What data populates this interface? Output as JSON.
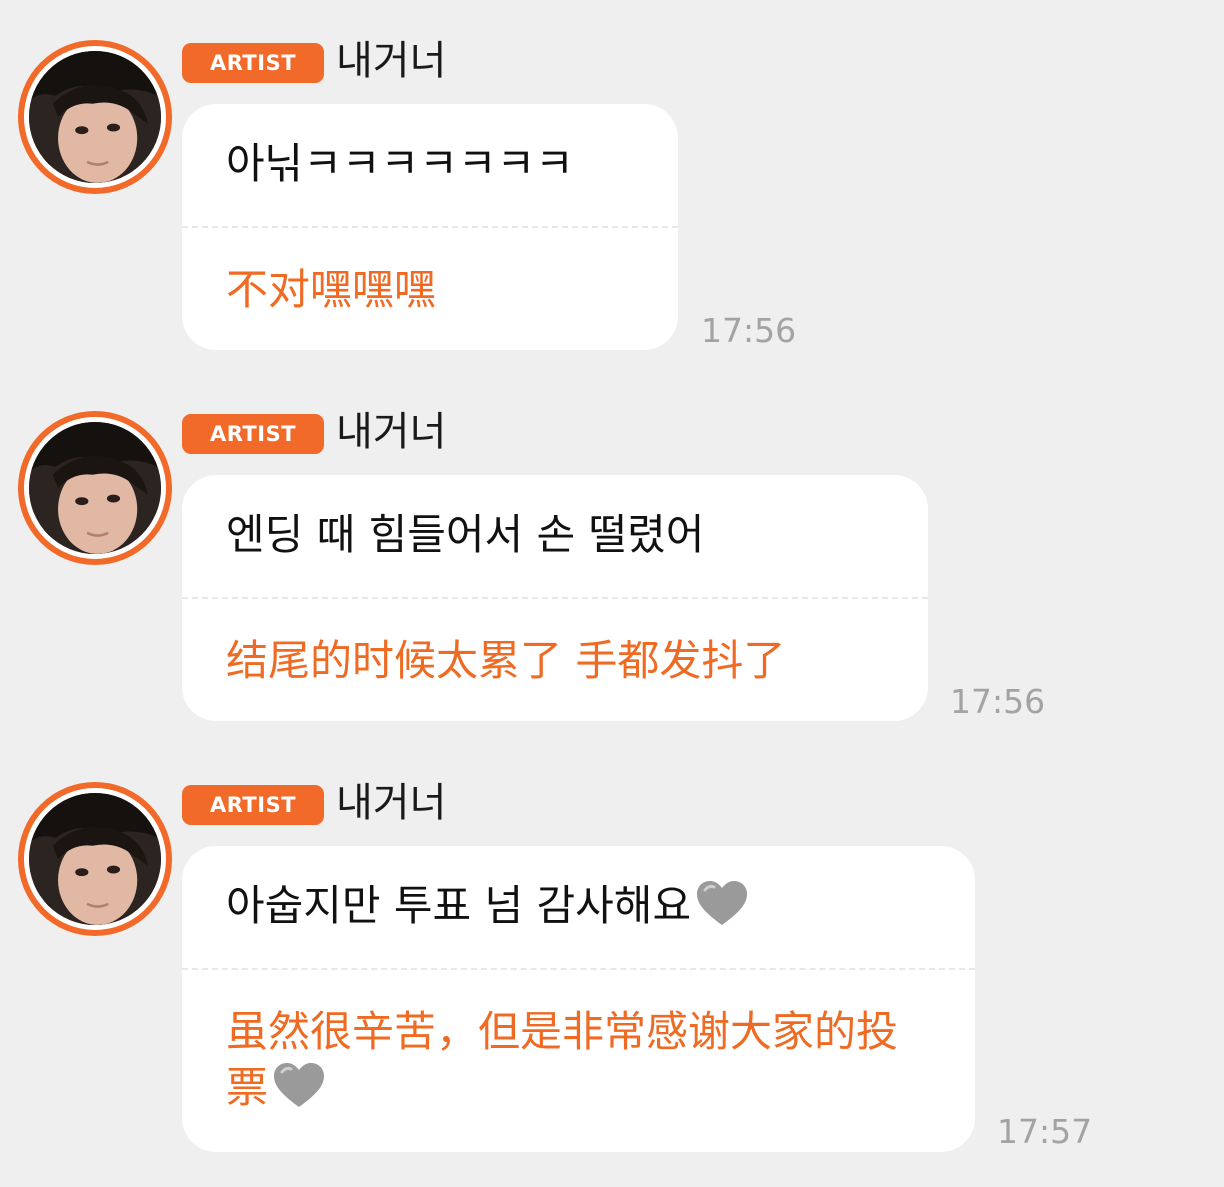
{
  "messages": [
    {
      "badge": "ARTIST",
      "name": "내거너",
      "korean": "아닊ㅋㅋㅋㅋㅋㅋㅋ",
      "chinese": "不对嘿嘿嘿",
      "time": "17:56"
    },
    {
      "badge": "ARTIST",
      "name": "내거너",
      "korean": "엔딩 때 힘들어서 손 떨렸어",
      "chinese": "结尾的时候太累了 手都发抖了",
      "time": "17:56"
    },
    {
      "badge": "ARTIST",
      "name": "내거너",
      "korean": "아숩지만 투표 넘 감사해요",
      "chinese": "虽然很辛苦，但是非常感谢大家的投票",
      "time": "17:57",
      "emoji": "grey-heart-icon"
    }
  ],
  "colors": {
    "accent": "#f26a2a",
    "translation_text": "#ef6b24",
    "background": "#efefef",
    "bubble": "#ffffff",
    "timestamp": "#a3a3a3"
  }
}
